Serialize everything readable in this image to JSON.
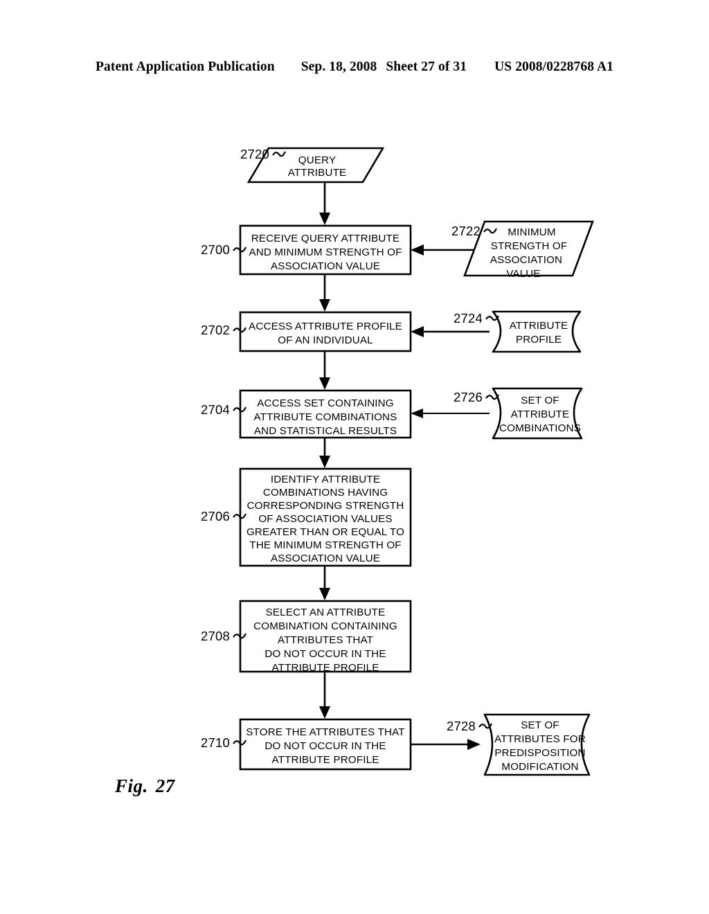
{
  "header": {
    "publication": "Patent Application Publication",
    "date": "Sep. 18, 2008",
    "sheet": "Sheet 27 of 31",
    "patent_number": "US 2008/0228768 A1"
  },
  "figure": {
    "label": "Fig.",
    "number": "27"
  },
  "diagram": {
    "type": "flowchart",
    "nodes": [
      {
        "id": "2720",
        "ref": "2720",
        "shape": "parallelogram",
        "role": "input",
        "lines": [
          "QUERY",
          "ATTRIBUTE"
        ],
        "column": "left"
      },
      {
        "id": "2700",
        "ref": "2700",
        "shape": "rectangle",
        "role": "process",
        "lines": [
          "RECEIVE QUERY ATTRIBUTE",
          "AND MINIMUM STRENGTH OF",
          "ASSOCIATION VALUE"
        ],
        "column": "left"
      },
      {
        "id": "2722",
        "ref": "2722",
        "shape": "parallelogram",
        "role": "input",
        "lines": [
          "MINIMUM",
          "STRENGTH OF",
          "ASSOCIATION",
          "VALUE"
        ],
        "column": "right"
      },
      {
        "id": "2702",
        "ref": "2702",
        "shape": "rectangle",
        "role": "process",
        "lines": [
          "ACCESS ATTRIBUTE PROFILE",
          "OF AN INDIVIDUAL"
        ],
        "column": "left"
      },
      {
        "id": "2724",
        "ref": "2724",
        "shape": "stored-data",
        "role": "data-store",
        "lines": [
          "ATTRIBUTE",
          "PROFILE"
        ],
        "column": "right"
      },
      {
        "id": "2704",
        "ref": "2704",
        "shape": "rectangle",
        "role": "process",
        "lines": [
          "ACCESS SET CONTAINING",
          "ATTRIBUTE COMBINATIONS",
          "AND STATISTICAL RESULTS"
        ],
        "column": "left"
      },
      {
        "id": "2726",
        "ref": "2726",
        "shape": "stored-data",
        "role": "data-store",
        "lines": [
          "SET OF",
          "ATTRIBUTE",
          "COMBINATIONS"
        ],
        "column": "right"
      },
      {
        "id": "2706",
        "ref": "2706",
        "shape": "rectangle",
        "role": "process",
        "lines": [
          "IDENTIFY ATTRIBUTE",
          "COMBINATIONS HAVING",
          "CORRESPONDING STRENGTH",
          "OF ASSOCIATION VALUES",
          "GREATER THAN OR EQUAL TO",
          "THE MINIMUM STRENGTH OF",
          "ASSOCIATION VALUE"
        ],
        "column": "left"
      },
      {
        "id": "2708",
        "ref": "2708",
        "shape": "rectangle",
        "role": "process",
        "lines": [
          "SELECT AN ATTRIBUTE",
          "COMBINATION CONTAINING",
          "ATTRIBUTES THAT",
          "DO NOT OCCUR IN THE",
          "ATTRIBUTE PROFILE"
        ],
        "column": "left"
      },
      {
        "id": "2710",
        "ref": "2710",
        "shape": "rectangle",
        "role": "process",
        "lines": [
          "STORE THE ATTRIBUTES THAT",
          "DO NOT OCCUR IN THE",
          "ATTRIBUTE PROFILE"
        ],
        "column": "left"
      },
      {
        "id": "2728",
        "ref": "2728",
        "shape": "stored-data",
        "role": "data-store",
        "lines": [
          "SET OF",
          "ATTRIBUTES FOR",
          "PREDISPOSITION",
          "MODIFICATION"
        ],
        "column": "right"
      }
    ],
    "edges": [
      {
        "from": "2720",
        "to": "2700",
        "direction": "down"
      },
      {
        "from": "2722",
        "to": "2700",
        "direction": "left"
      },
      {
        "from": "2700",
        "to": "2702",
        "direction": "down"
      },
      {
        "from": "2724",
        "to": "2702",
        "direction": "left"
      },
      {
        "from": "2702",
        "to": "2704",
        "direction": "down"
      },
      {
        "from": "2726",
        "to": "2704",
        "direction": "left"
      },
      {
        "from": "2704",
        "to": "2706",
        "direction": "down"
      },
      {
        "from": "2706",
        "to": "2708",
        "direction": "down"
      },
      {
        "from": "2708",
        "to": "2710",
        "direction": "down"
      },
      {
        "from": "2710",
        "to": "2728",
        "direction": "right"
      }
    ]
  },
  "text": {
    "n2720_l0": "QUERY",
    "n2720_l1": "ATTRIBUTE",
    "n2700_l0": "RECEIVE QUERY ATTRIBUTE",
    "n2700_l1": "AND MINIMUM STRENGTH OF",
    "n2700_l2": "ASSOCIATION VALUE",
    "n2722_l0": "MINIMUM",
    "n2722_l1": "STRENGTH OF",
    "n2722_l2": "ASSOCIATION",
    "n2722_l3": "VALUE",
    "n2702_l0": "ACCESS ATTRIBUTE PROFILE",
    "n2702_l1": "OF AN INDIVIDUAL",
    "n2724_l0": "ATTRIBUTE",
    "n2724_l1": "PROFILE",
    "n2704_l0": "ACCESS SET CONTAINING",
    "n2704_l1": "ATTRIBUTE COMBINATIONS",
    "n2704_l2": "AND STATISTICAL RESULTS",
    "n2726_l0": "SET OF",
    "n2726_l1": "ATTRIBUTE",
    "n2726_l2": "COMBINATIONS",
    "n2706_l0": "IDENTIFY ATTRIBUTE",
    "n2706_l1": "COMBINATIONS HAVING",
    "n2706_l2": "CORRESPONDING STRENGTH",
    "n2706_l3": "OF ASSOCIATION VALUES",
    "n2706_l4": "GREATER THAN OR EQUAL TO",
    "n2706_l5": "THE MINIMUM STRENGTH OF",
    "n2706_l6": "ASSOCIATION VALUE",
    "n2708_l0": "SELECT AN ATTRIBUTE",
    "n2708_l1": "COMBINATION CONTAINING",
    "n2708_l2": "ATTRIBUTES THAT",
    "n2708_l3": "DO NOT OCCUR IN THE",
    "n2708_l4": "ATTRIBUTE PROFILE",
    "n2710_l0": "STORE THE ATTRIBUTES THAT",
    "n2710_l1": "DO NOT OCCUR IN THE",
    "n2710_l2": "ATTRIBUTE PROFILE",
    "n2728_l0": "SET OF",
    "n2728_l1": "ATTRIBUTES FOR",
    "n2728_l2": "PREDISPOSITION",
    "n2728_l3": "MODIFICATION",
    "ref_2720": "2720",
    "ref_2700": "2700",
    "ref_2722": "2722",
    "ref_2702": "2702",
    "ref_2724": "2724",
    "ref_2704": "2704",
    "ref_2726": "2726",
    "ref_2706": "2706",
    "ref_2708": "2708",
    "ref_2710": "2710",
    "ref_2728": "2728"
  },
  "colors": {
    "ink": "#000000",
    "paper": "#ffffff"
  }
}
